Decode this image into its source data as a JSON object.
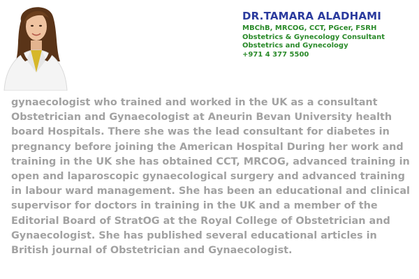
{
  "profile": {
    "name": "DR.TAMARA ALADHAMI",
    "credentials": [
      "MBChB, MRCOG, CCT, PGcer, FSRH",
      "Obstetrics & Gynecology Consultant",
      "Obstetrics and Gynecology",
      "+971 4 377 5500"
    ]
  },
  "bio": {
    "text": "gynaecologist who trained and worked in the UK as a consultant Obstetrician and Gynaecologist at Aneurin Bevan University health board Hospitals. There she was the lead consultant for diabetes in pregnancy before joining the American Hospital During her work and training in the UK she has obtained CCT, MRCOG, advanced training in open and laparoscopic gynaecological surgery and advanced training in labour ward management. She has been an educational and clinical supervisor for doctors in training in the UK and a member of the Editorial Board of StratOG at the Royal College of Obstetrician and Gynaecologist. She has published several educational articles in British journal of Obstetrician and Gynaecologist."
  },
  "colors": {
    "name": "#2b3b9e",
    "credentials": "#2a8a2a",
    "bio": "#a2a2a2"
  }
}
